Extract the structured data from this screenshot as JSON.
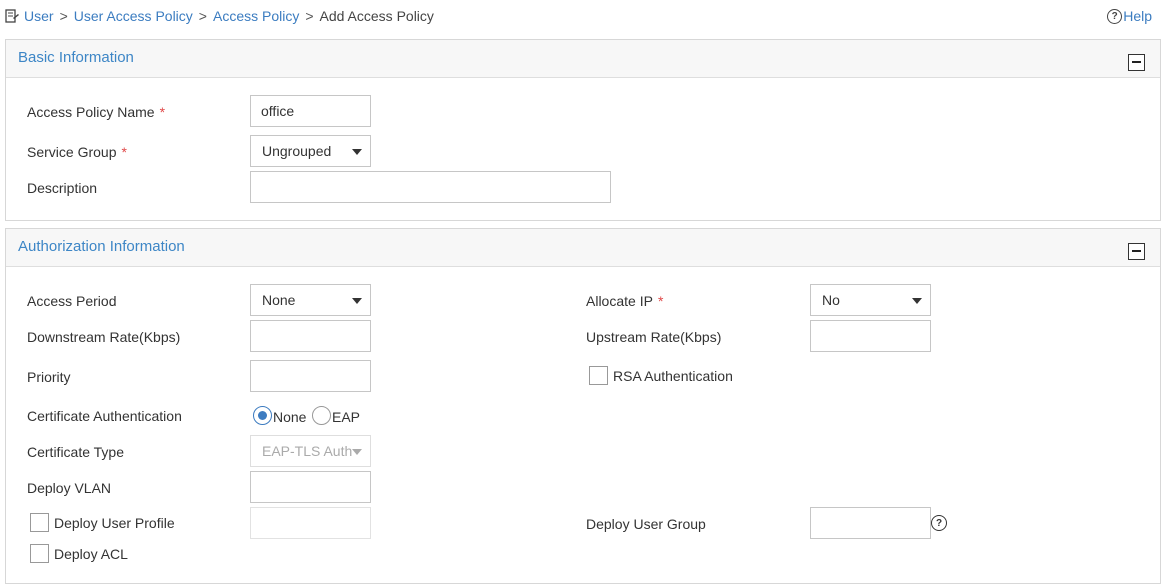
{
  "breadcrumb": {
    "items": [
      "User",
      "User Access Policy",
      "Access Policy"
    ],
    "separator": ">",
    "current": "Add Access Policy"
  },
  "help": {
    "label": "Help",
    "icon": "question-circle-icon"
  },
  "basic": {
    "title": "Basic Information",
    "policy_name": {
      "label": "Access Policy Name",
      "required": "*",
      "value": "office"
    },
    "service_group": {
      "label": "Service Group",
      "required": "*",
      "value": "Ungrouped"
    },
    "description": {
      "label": "Description",
      "value": ""
    }
  },
  "auth": {
    "title": "Authorization Information",
    "access_period": {
      "label": "Access Period",
      "value": "None"
    },
    "allocate_ip": {
      "label": "Allocate IP",
      "required": "*",
      "value": "No"
    },
    "downstream": {
      "label": "Downstream Rate(Kbps)",
      "value": ""
    },
    "upstream": {
      "label": "Upstream Rate(Kbps)",
      "value": ""
    },
    "priority": {
      "label": "Priority",
      "value": ""
    },
    "rsa": {
      "label": "RSA Authentication",
      "checked": false
    },
    "cert_auth": {
      "label": "Certificate Authentication",
      "options": [
        "None",
        "EAP"
      ],
      "selected": "None"
    },
    "cert_type": {
      "label": "Certificate Type",
      "value": "EAP-TLS AuthN",
      "disabled": true
    },
    "deploy_vlan": {
      "label": "Deploy VLAN",
      "value": ""
    },
    "deploy_user_profile": {
      "label": "Deploy User Profile",
      "checked": false,
      "value": ""
    },
    "deploy_user_group": {
      "label": "Deploy User Group",
      "value": ""
    },
    "deploy_acl": {
      "label": "Deploy ACL",
      "checked": false
    }
  },
  "colors": {
    "link": "#3b7cc0",
    "panel_title": "#3d86c6",
    "required": "#e04848",
    "radio_on": "#3d7cc0"
  }
}
